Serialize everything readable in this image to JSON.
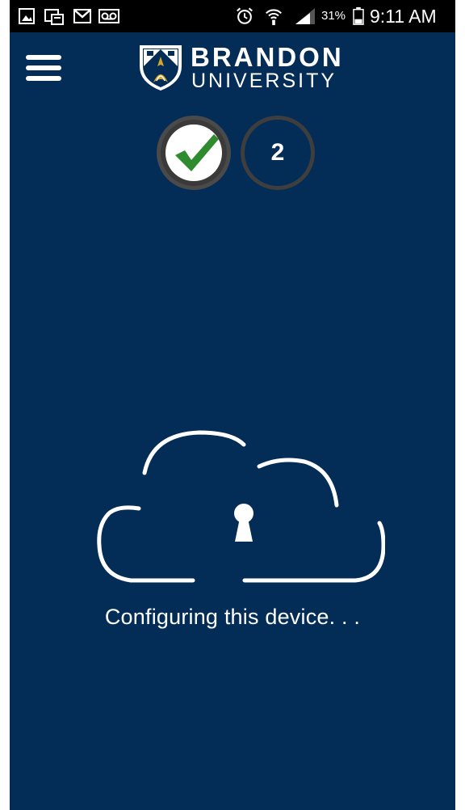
{
  "status_bar": {
    "notification_icons": [
      "gallery-icon",
      "screenshot-icon",
      "gmail-icon",
      "voicemail-icon"
    ],
    "system_icons": [
      "alarm-icon",
      "wifi-icon",
      "signal-icon",
      "battery-icon"
    ],
    "battery_percent": "31%",
    "time": "9:11 AM"
  },
  "header": {
    "menu_icon": "hamburger-menu-icon",
    "logo": {
      "line1": "BRANDON",
      "line2": "UNIVERSITY",
      "crest_icon": "brandon-crest-icon"
    }
  },
  "steps": [
    {
      "state": "complete",
      "icon": "checkmark-icon"
    },
    {
      "state": "current",
      "label": "2"
    }
  ],
  "main": {
    "illustration_icon": "cloud-lock-icon",
    "message": "Configuring this device. . ."
  },
  "colors": {
    "background": "#032d57",
    "status_bar": "#000000",
    "check_green": "#2e8b2e",
    "text": "#ffffff"
  }
}
